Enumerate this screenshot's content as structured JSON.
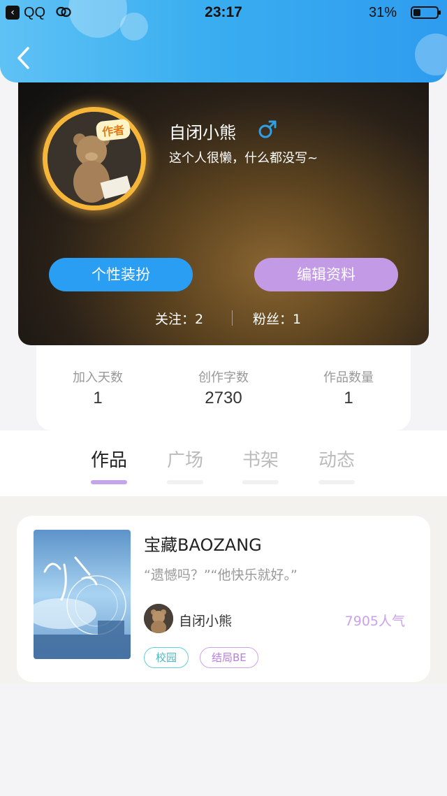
{
  "status_bar": {
    "app_name": "QQ",
    "time": "23:17",
    "battery": "31%",
    "battery_level": 0.31
  },
  "profile": {
    "author_tag": "作者",
    "username": "自闭小熊",
    "gender": "male",
    "bio": "这个人很懒，什么都没写~",
    "buttons": {
      "dress_up": "个性装扮",
      "edit_profile": "编辑资料"
    },
    "following": "关注：2",
    "fans": "粉丝：1"
  },
  "stats": [
    {
      "label": "加入天数",
      "value": "1"
    },
    {
      "label": "创作字数",
      "value": "2730"
    },
    {
      "label": "作品数量",
      "value": "1"
    }
  ],
  "tabs": [
    {
      "label": "作品",
      "active": true
    },
    {
      "label": "广场",
      "active": false
    },
    {
      "label": "书架",
      "active": false
    },
    {
      "label": "动态",
      "active": false
    }
  ],
  "work": {
    "title": "宝藏BAOZANG",
    "quote": "“遗憾吗？”“他快乐就好。”",
    "author": "自闭小熊",
    "popularity": "7905人气",
    "tags": [
      "校园",
      "结局BE"
    ]
  },
  "colors": {
    "header": "#3aaef0",
    "accent_blue": "#2a9ef2",
    "accent_purple": "#c39ae6",
    "tag_cyan": "#5fd0db",
    "tag_purple": "#cfa3ea"
  }
}
